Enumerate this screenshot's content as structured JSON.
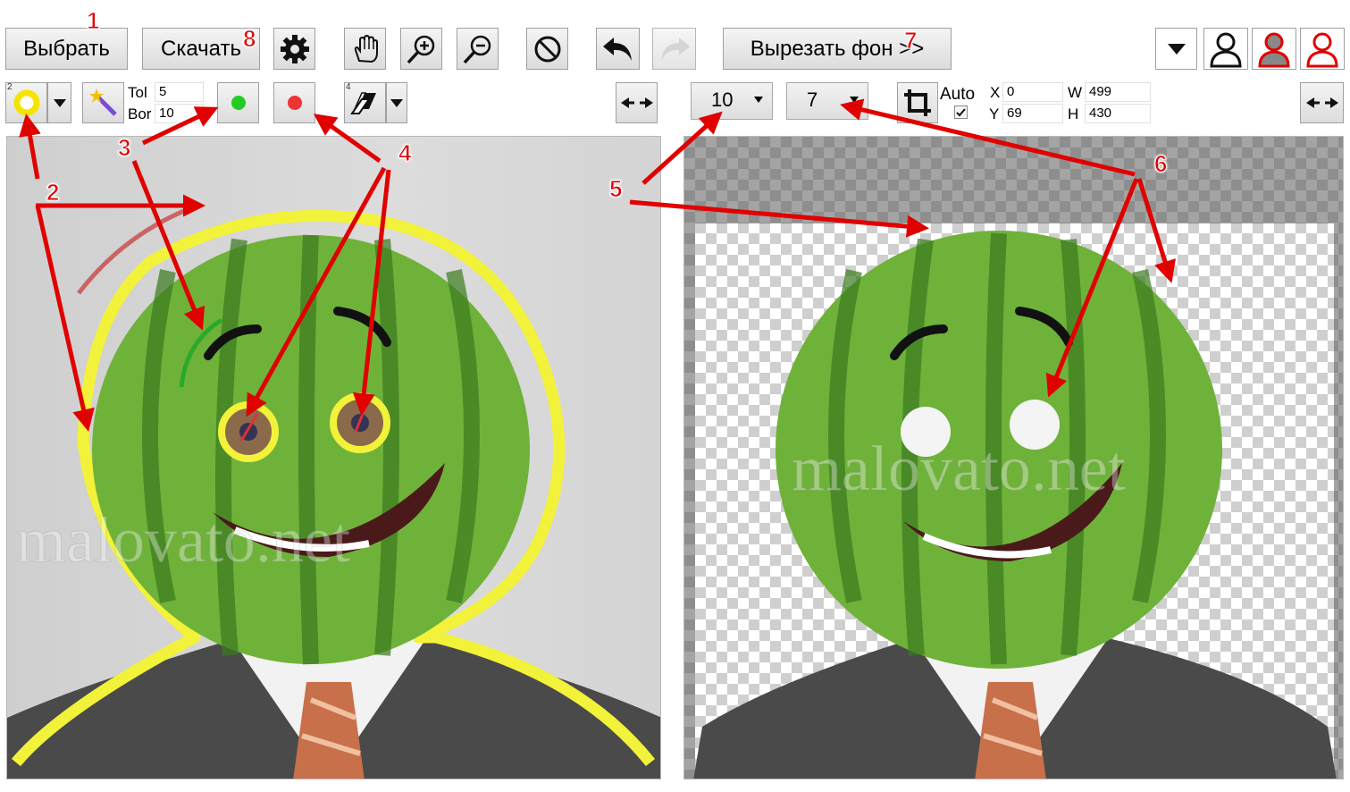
{
  "toolbar": {
    "select_label": "Выбрать",
    "download_label": "Скачать",
    "cut_bg_label": "Вырезать фон >>"
  },
  "row2": {
    "brush_size": "2",
    "eraser_size": "4",
    "tol_label": "Tol",
    "tol_value": "5",
    "bor_label": "Bor",
    "bor_value": "10",
    "blur_select": "10",
    "border_select": "7",
    "auto_label": "Auto",
    "crop": {
      "x_label": "X",
      "x": "0",
      "y_label": "Y",
      "y": "69",
      "w_label": "W",
      "w": "499",
      "h_label": "H",
      "h": "430"
    }
  },
  "annotations": {
    "n1": "1",
    "n2": "2",
    "n3": "3",
    "n4": "4",
    "n5": "5",
    "n6": "6",
    "n7": "7",
    "n8": "8"
  },
  "watermark": "malovato.net",
  "colors": {
    "accent_red": "#e00000",
    "keep_marker": "#22cc22",
    "remove_marker": "#ee3333",
    "selection_yellow": "#f2f23a"
  },
  "icons": [
    "gear-icon",
    "hand-icon",
    "zoom-in-icon",
    "zoom-out-icon",
    "cancel-icon",
    "undo-icon",
    "redo-icon",
    "user-outline-icon",
    "user-gray-icon",
    "user-red-icon",
    "magic-wand-icon",
    "eraser-icon",
    "swap-arrows-icon",
    "crop-icon"
  ]
}
